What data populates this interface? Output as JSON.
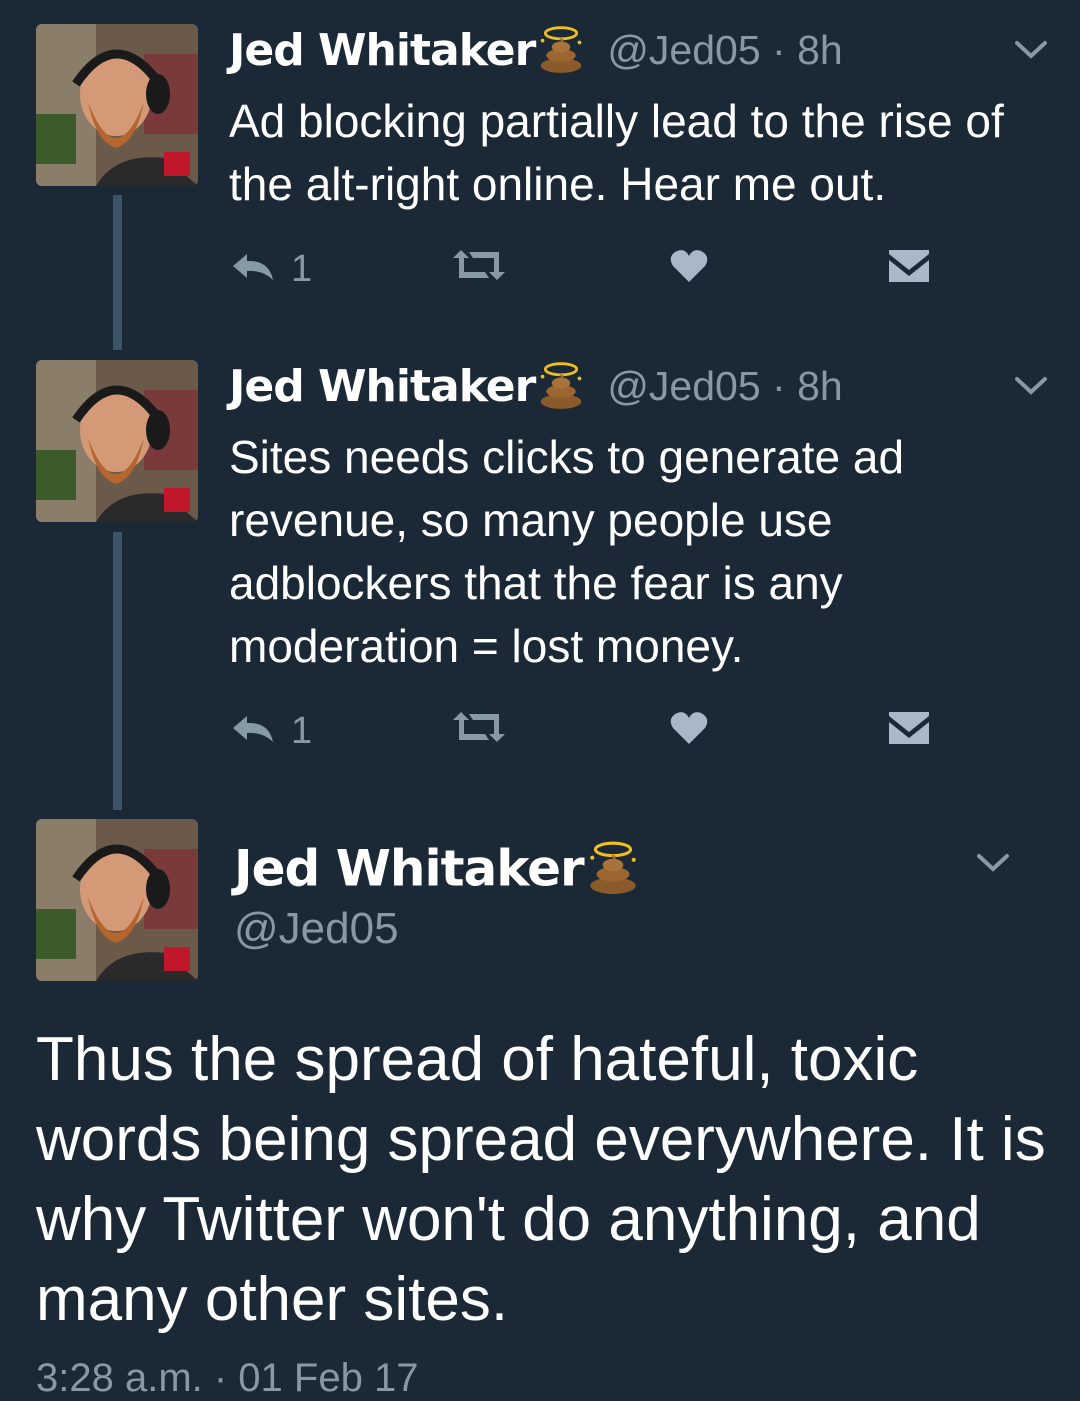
{
  "tweets": [
    {
      "name": "Jed Whitaker",
      "name_emoji": "poop-halo-emoji",
      "handle_time": "@Jed05 · 8h",
      "text": "Ad blocking partially lead to the rise of the alt-right online. Hear me out.",
      "reply_count": "1",
      "icons": [
        "reply-icon",
        "retweet-icon",
        "heart-icon",
        "dm-icon",
        "chevron-down-icon"
      ]
    },
    {
      "name": "Jed Whitaker",
      "name_emoji": "poop-halo-emoji",
      "handle_time": "@Jed05 · 8h",
      "text": "Sites needs clicks to generate ad revenue, so many people use adblockers that the fear is any moderation = lost money.",
      "reply_count": "1",
      "icons": [
        "reply-icon",
        "retweet-icon",
        "heart-icon",
        "dm-icon",
        "chevron-down-icon"
      ]
    }
  ],
  "main_tweet": {
    "name": "Jed Whitaker",
    "handle": "@Jed05",
    "text": "Thus the spread of hateful, toxic words being spread everywhere. It is why Twitter won't do anything, and many other sites.",
    "timestamp": "3:28 a.m. · 01 Feb 17"
  },
  "colors": {
    "background": "#1b2836",
    "secondary_text": "#8899a6",
    "action_icon": "#8899a6",
    "heart_icon": "#a8b8c8",
    "thread_line": "#3d5466"
  }
}
